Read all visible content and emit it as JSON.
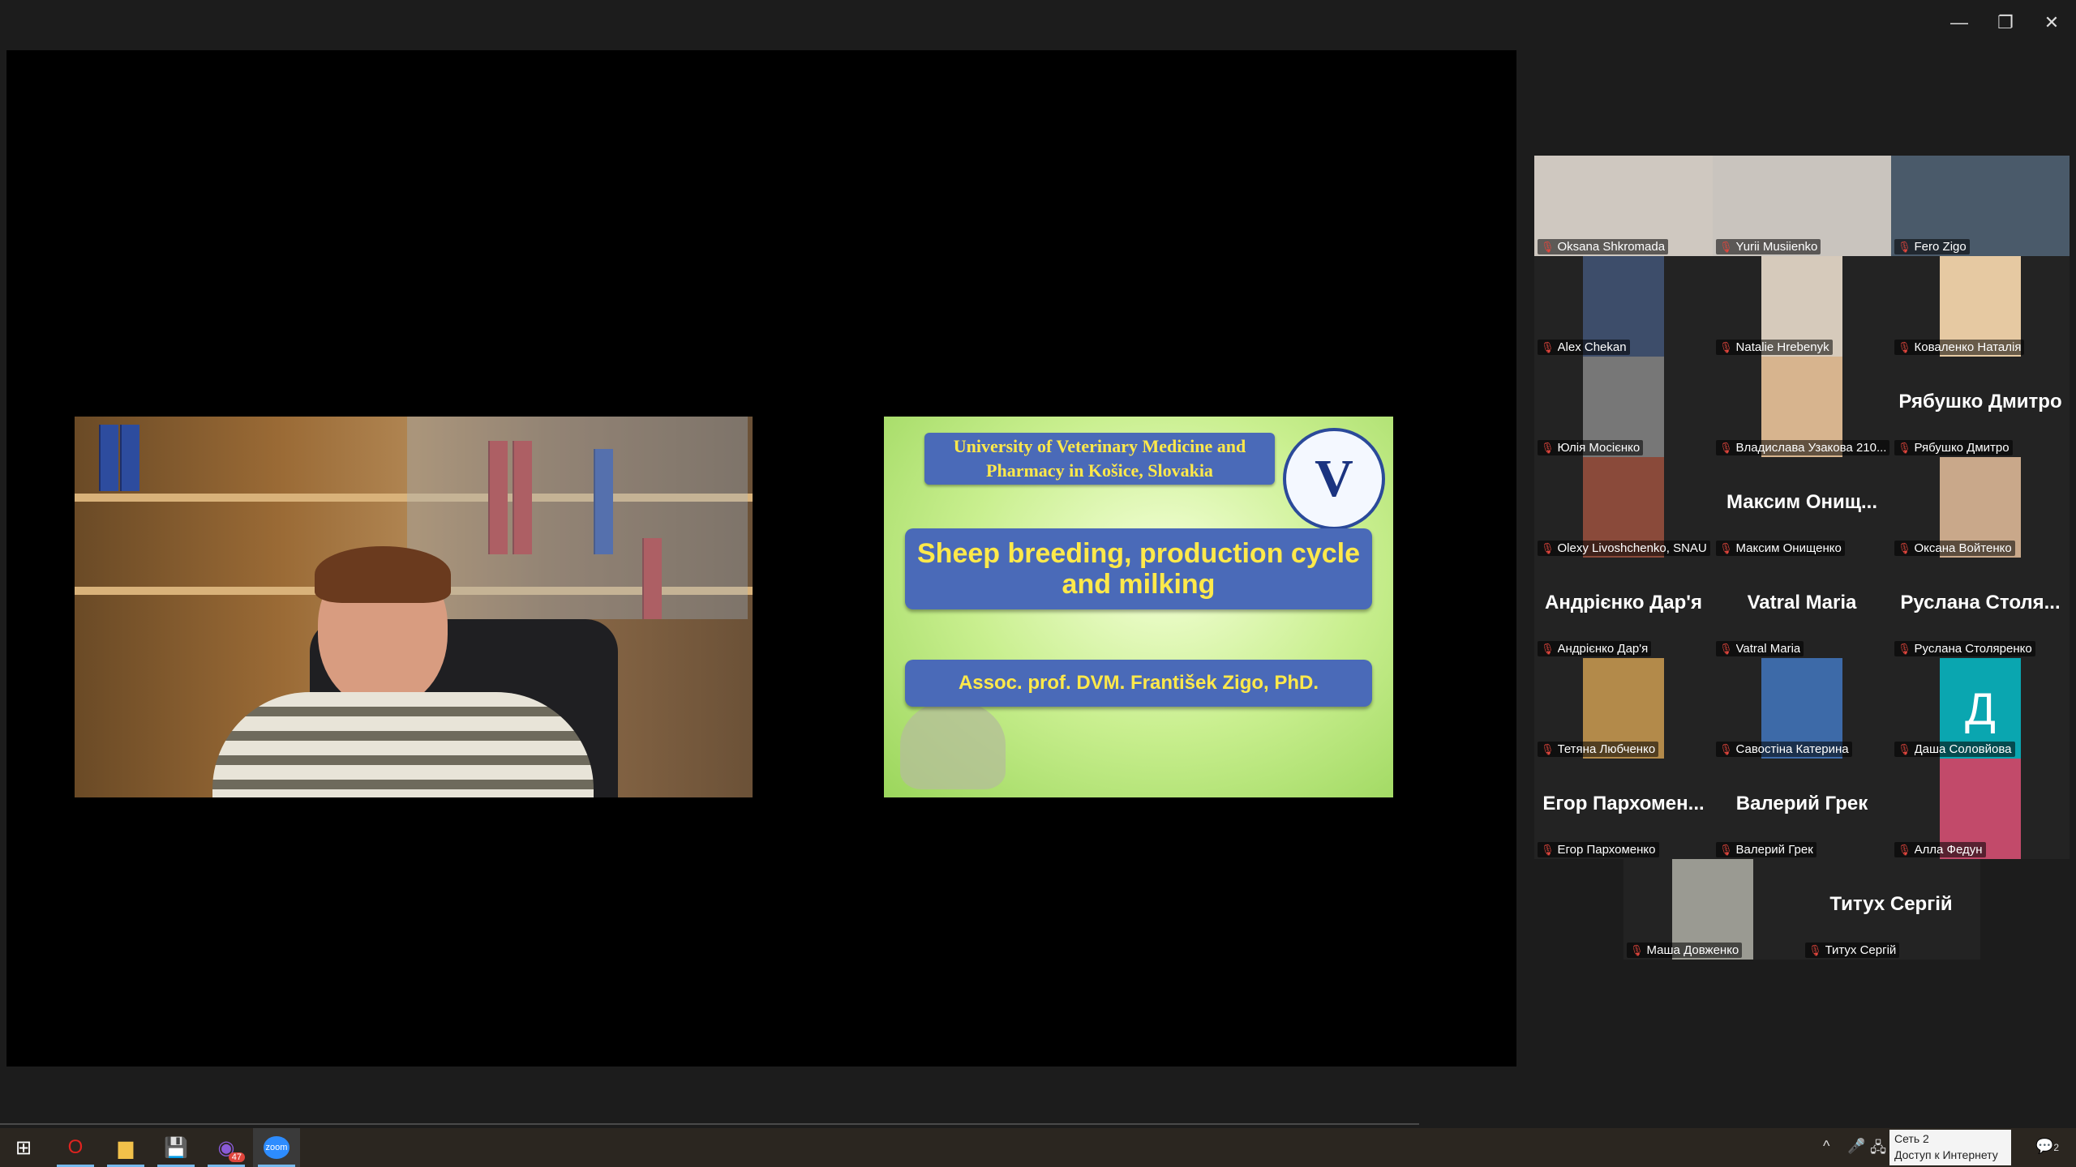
{
  "window": {
    "minimize_glyph": "—",
    "restore_glyph": "❐",
    "close_glyph": "✕"
  },
  "slide": {
    "university": "University of Veterinary Medicine and Pharmacy in Košice, Slovakia",
    "logo_letter": "V",
    "title": "Sheep breeding, production cycle and milking",
    "author": "Assoc. prof. DVM. František Zigo, PhD."
  },
  "participants": [
    {
      "name": "Oksana Shkromada",
      "display": "",
      "tile_color": "#cfc8c0",
      "has_video": true
    },
    {
      "name": "Yurii Musiienko",
      "display": "",
      "tile_color": "#c9c4be",
      "has_video": true
    },
    {
      "name": "Fero Zigo",
      "display": "",
      "tile_color": "#4a5a6a",
      "has_video": true,
      "active": true
    },
    {
      "name": "Alex Chekan",
      "display": "",
      "tile_color": "#3d4d6a",
      "has_video": true
    },
    {
      "name": "Natalie Hrebenyk",
      "display": "",
      "tile_color": "#d6cabb",
      "has_video": true
    },
    {
      "name": "Коваленко Наталія",
      "display": "",
      "tile_color": "#e6c9a2",
      "has_video": true
    },
    {
      "name": "Юлія Мосієнко",
      "display": "",
      "tile_color": "#777",
      "has_video": true
    },
    {
      "name": "Владислава Узакова 210...",
      "display": "",
      "tile_color": "#d7b48e",
      "has_video": true
    },
    {
      "name": "Рябушко Дмитро",
      "display": "Рябушко Дмитро",
      "has_video": false
    },
    {
      "name": "Olexy Livoshchenko, SNAU",
      "display": "",
      "tile_color": "#8a4a3a",
      "has_video": true
    },
    {
      "name": "Максим Онищенко",
      "display": "Максим Онищ...",
      "has_video": false
    },
    {
      "name": "Оксана Войтенко",
      "display": "",
      "tile_color": "#c9a88a",
      "has_video": true
    },
    {
      "name": "Андрієнко Дар'я",
      "display": "Андрієнко Дар'я",
      "has_video": false
    },
    {
      "name": "Vatral Maria",
      "display": "Vatral Maria",
      "has_video": false
    },
    {
      "name": "Руслана Столяренко",
      "display": "Руслана Столя...",
      "has_video": false
    },
    {
      "name": "Тетяна Любченко",
      "display": "",
      "tile_color": "#b38a4a",
      "has_video": true
    },
    {
      "name": "Савостіна Катерина",
      "display": "",
      "tile_color": "#3d6aa8",
      "has_video": true
    },
    {
      "name": "Даша Соловйова",
      "display": "Д",
      "tile_color": "#0aa6b0",
      "has_video": true,
      "letter": true
    },
    {
      "name": "Егор Пархоменко",
      "display": "Егор Пархомен...",
      "has_video": false
    },
    {
      "name": "Валерий Грек",
      "display": "Валерий Грек",
      "has_video": false
    },
    {
      "name": "Алла Федун",
      "display": "",
      "tile_color": "#c24a6a",
      "has_video": true
    },
    {
      "name": "Маша Довженко",
      "display": "",
      "tile_color": "#9a9a92",
      "has_video": true
    },
    {
      "name": "Титух Сергій",
      "display": "Титух Сергій",
      "has_video": false
    }
  ],
  "taskbar": {
    "start_glyph": "⊞",
    "apps": [
      {
        "name": "Opera",
        "glyph": "O",
        "color": "#e0231f"
      },
      {
        "name": "File Explorer",
        "glyph": "▆",
        "color": "#f2c14a"
      },
      {
        "name": "Save",
        "glyph": "💾",
        "color": "#5a7ad8"
      },
      {
        "name": "Viber",
        "glyph": "◉",
        "color": "#8a5ad8",
        "badge": "47"
      },
      {
        "name": "Zoom",
        "glyph": "zoom",
        "color": "#2d8cff"
      }
    ],
    "tray": {
      "network_line1": "Сеть 2",
      "network_line2": "Доступ к Интернету",
      "notifications_count": "2"
    }
  }
}
